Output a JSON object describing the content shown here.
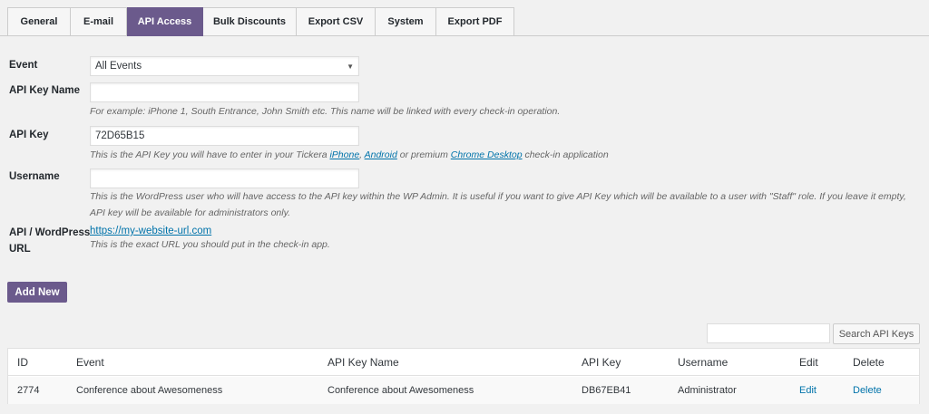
{
  "tabs": [
    {
      "label": "General"
    },
    {
      "label": "E-mail"
    },
    {
      "label": "API Access",
      "active": true
    },
    {
      "label": "Bulk Discounts"
    },
    {
      "label": "Export CSV"
    },
    {
      "label": "System"
    },
    {
      "label": "Export PDF"
    }
  ],
  "form": {
    "event_label": "Event",
    "event_value": "All Events",
    "key_name_label": "API Key Name",
    "key_name_value": "",
    "key_name_desc": "For example: iPhone 1, South Entrance, John Smith etc. This name will be linked with every check-in operation.",
    "api_key_label": "API Key",
    "api_key_value": "72D65B15",
    "api_key_desc_pre": "This is the API Key you will have to enter in your Tickera ",
    "api_key_link1": "iPhone",
    "api_key_sep": ", ",
    "api_key_link2": "Android",
    "api_key_desc_mid": " or premium ",
    "api_key_link3": "Chrome Desktop",
    "api_key_desc_post": " check-in application",
    "username_label": "Username",
    "username_value": "",
    "username_desc": "This is the WordPress user who will have access to the API key within the WP Admin. It is useful if you want to give API Key which will be available to a user with \"Staff\" role. If you leave it empty, API key will be available for administrators only.",
    "url_label_line1": "API / WordPress",
    "url_label_line2": "URL",
    "url_value": "https://my-website-url.com",
    "url_desc": "This is the exact URL you should put in the check-in app.",
    "add_new_label": "Add New"
  },
  "search": {
    "value": "",
    "button_label": "Search API Keys"
  },
  "table": {
    "headers": {
      "id": "ID",
      "event": "Event",
      "key_name": "API Key Name",
      "api_key": "API Key",
      "username": "Username",
      "edit": "Edit",
      "delete": "Delete"
    },
    "rows": [
      {
        "id": "2774",
        "event": "Conference about Awesomeness",
        "key_name": "Conference about Awesomeness",
        "api_key": "DB67EB41",
        "username": "Administrator",
        "edit": "Edit",
        "delete": "Delete"
      }
    ]
  },
  "colors": {
    "accent": "#6b5a8c",
    "link": "#0073aa"
  }
}
